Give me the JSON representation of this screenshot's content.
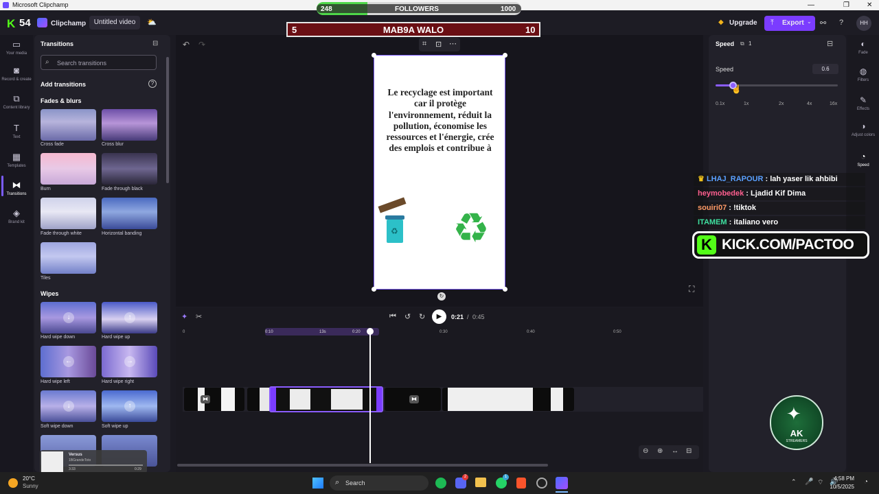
{
  "window": {
    "title": "Microsoft Clipchamp",
    "controls": [
      "—",
      "❐",
      "✕"
    ]
  },
  "overlay": {
    "followers": {
      "current": "248",
      "label": "FOLLOWERS",
      "goal": "1000",
      "progress": 0.248
    },
    "score": {
      "left": "5",
      "title": "MAB9A WALO",
      "right": "10"
    },
    "kick_count": "54",
    "kick_banner": "KICK.COM/PACTOO",
    "logo_text": "AK STREAMERS",
    "chat": [
      {
        "user": "LHAJ_RAPOUR",
        "msg": "lah yaser lik ahbibi",
        "color": "#5aa0ff",
        "crown": true
      },
      {
        "user": "heymobedek",
        "msg": "Ljadid Kif Dima",
        "color": "#ff5f8f",
        "crown": false
      },
      {
        "user": "souiri07",
        "msg": "!tiktok",
        "color": "#ff9a66",
        "crown": false
      },
      {
        "user": "ITAMEM",
        "msg": "italiano vero",
        "color": "#3fe0a0",
        "crown": false
      }
    ]
  },
  "topbar": {
    "app_name": "Clipchamp",
    "project_title": "Untitled video",
    "upgrade": "Upgrade",
    "export": "Export",
    "avatar": "HH",
    "help": "?"
  },
  "left_rail": [
    {
      "label": "Your media",
      "icon": "folder-icon",
      "glyph": "▭"
    },
    {
      "label": "Record & create",
      "icon": "camera-icon",
      "glyph": "◙"
    },
    {
      "label": "Content library",
      "icon": "library-icon",
      "glyph": "⧉"
    },
    {
      "label": "Text",
      "icon": "text-icon",
      "glyph": "T"
    },
    {
      "label": "Templates",
      "icon": "templates-icon",
      "glyph": "▦"
    },
    {
      "label": "Transitions",
      "icon": "transitions-icon",
      "glyph": "⧓"
    },
    {
      "label": "Brand kit",
      "icon": "brand-icon",
      "glyph": "◈"
    }
  ],
  "transitions_panel": {
    "title": "Transitions",
    "search_placeholder": "Search transitions",
    "add_heading": "Add transitions",
    "sections": [
      {
        "title": "Fades & blurs",
        "items": [
          {
            "label": "Cross fade",
            "grad": "linear-gradient(180deg,#8a94c8 0%,#b7b4dc 40%,#6a6aa8 100%)",
            "arrow": ""
          },
          {
            "label": "Cross blur",
            "grad": "linear-gradient(180deg,#6d4fa8 0%,#b795d8 45%,#473a78 100%)",
            "arrow": ""
          },
          {
            "label": "Burn",
            "grad": "linear-gradient(180deg,#f6b9d0 0%,#e8c9e6 50%,#c8a8d8 100%)",
            "arrow": ""
          },
          {
            "label": "Fade through black",
            "grad": "linear-gradient(180deg,#3a3450 0%,#6e6690 50%,#2a2638 100%)",
            "arrow": ""
          },
          {
            "label": "Fade through white",
            "grad": "linear-gradient(180deg,#cfd2ea 0%,#e8e8f4 45%,#9fa2c8 100%)",
            "arrow": ""
          },
          {
            "label": "Horizontal banding",
            "grad": "linear-gradient(180deg,#4a6ac0 0%,#8fa8e0 45%,#3a4a98 100%)",
            "arrow": ""
          },
          {
            "label": "Tiles",
            "grad": "linear-gradient(180deg,#9ea6e0 0%,#c3c8f0 45%,#7280c8 100%)",
            "arrow": ""
          }
        ]
      },
      {
        "title": "Wipes",
        "items": [
          {
            "label": "Hard wipe down",
            "grad": "linear-gradient(180deg,#5d6ed0 0%,#a898e0 50%,#4a4890 100%)",
            "arrow": "↓"
          },
          {
            "label": "Hard wipe up",
            "grad": "linear-gradient(180deg,#4a5ac8 0%,#d8d0f0 55%,#3a3a88 100%)",
            "arrow": "↑"
          },
          {
            "label": "Hard wipe left",
            "grad": "linear-gradient(90deg,#5d6ed0 0%,#a898e0 50%,#6a4a98 100%)",
            "arrow": "←"
          },
          {
            "label": "Hard wipe right",
            "grad": "linear-gradient(90deg,#7b6ad0 0%,#c8b8f0 50%,#5a4ab8 100%)",
            "arrow": "→"
          },
          {
            "label": "Soft wipe down",
            "grad": "linear-gradient(180deg,#6a7ad0 0%,#b8b0e8 50%,#4a5098 100%)",
            "arrow": "↓"
          },
          {
            "label": "Soft wipe up",
            "grad": "linear-gradient(180deg,#4a6ad0 0%,#9fb8f0 50%,#3a4a98 100%)",
            "arrow": "↑"
          }
        ]
      }
    ]
  },
  "preview": {
    "text": "Le recyclage est important car il protège l'environnement, réduit la pollution, économise les ressources et l'énergie, crée des emplois et contribue à"
  },
  "timeline": {
    "current": "0:21",
    "total": "0:45",
    "duration_badge": "13s",
    "ticks": [
      "0",
      "0:10",
      "0:20",
      "0:30",
      "0:40",
      "0:50"
    ]
  },
  "speed_panel": {
    "title": "Speed",
    "count": "1",
    "label": "Speed",
    "value": "0.6",
    "marks": [
      "0.1x",
      "1x",
      "2x",
      "4x",
      "16x"
    ]
  },
  "right_rail": [
    {
      "label": "Fade",
      "icon": "fade-icon",
      "glyph": "◐"
    },
    {
      "label": "Filters",
      "icon": "filters-icon",
      "glyph": "◍"
    },
    {
      "label": "Effects",
      "icon": "effects-icon",
      "glyph": "✎"
    },
    {
      "label": "Adjust colors",
      "icon": "adjust-colors-icon",
      "glyph": "◑"
    },
    {
      "label": "Speed",
      "icon": "speed-icon",
      "glyph": "◔"
    }
  ],
  "music_widget": {
    "track": "Versus",
    "artist": "1BGrandeToto",
    "elapsed": "3:33",
    "total": "0:29"
  },
  "taskbar": {
    "weather_temp": "20°C",
    "weather_desc": "Sunny",
    "search": "Search",
    "time": "4:58 PM",
    "date": "10/5/2025",
    "badge_discord": "2",
    "badge_whatsapp": "1"
  }
}
